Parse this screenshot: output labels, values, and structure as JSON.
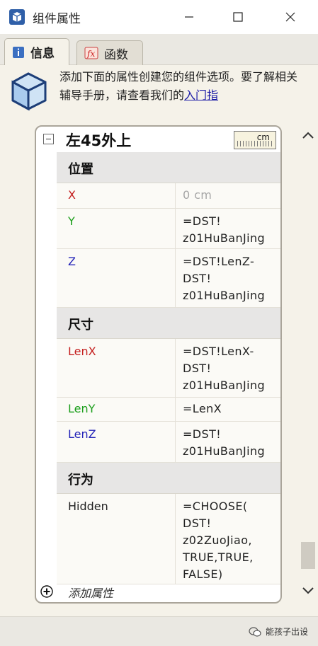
{
  "window": {
    "title": "组件属性",
    "minimize_glyph": "—",
    "maximize_glyph": "☐",
    "close_glyph": "✕"
  },
  "tabs": [
    {
      "label": "信息",
      "icon": "info-icon",
      "active": true
    },
    {
      "label": "函数",
      "icon": "fx-icon",
      "active": false
    }
  ],
  "toolbar": {
    "refresh_icon": "refresh-icon",
    "formula_icon": "formula-fx-icon"
  },
  "banner": {
    "text": "添加下面的属性创建您的组件选项。要了解相关辅导手册，请查看我们的",
    "link": "入门指"
  },
  "component": {
    "name": "左45外上",
    "unit": "cm",
    "sections": [
      {
        "title": "位置",
        "rows": [
          {
            "name": "X",
            "value": "0 cm"
          },
          {
            "name": "Y",
            "value": "=DST!\nz01HuBanJing"
          },
          {
            "name": "Z",
            "value": "=DST!LenZ-\nDST!\nz01HuBanJing"
          }
        ]
      },
      {
        "title": "尺寸",
        "rows": [
          {
            "name": "LenX",
            "value": "=DST!LenX-\nDST!\nz01HuBanJing"
          },
          {
            "name": "LenY",
            "value": "=LenX"
          },
          {
            "name": "LenZ",
            "value": "=DST!\nz01HuBanJing"
          }
        ]
      },
      {
        "title": "行为",
        "rows": [
          {
            "name": "Hidden",
            "value": "=CHOOSE(\nDST!\nz02ZuoJiao,\nTRUE,TRUE,\nFALSE)"
          }
        ]
      }
    ],
    "add_attribute": "添加属性"
  },
  "colors": {
    "x": "#c41e1e",
    "y": "#1a9e1a",
    "z": "#2323b8",
    "link": "#1a1aa6"
  },
  "watermark": "能孩子出设"
}
